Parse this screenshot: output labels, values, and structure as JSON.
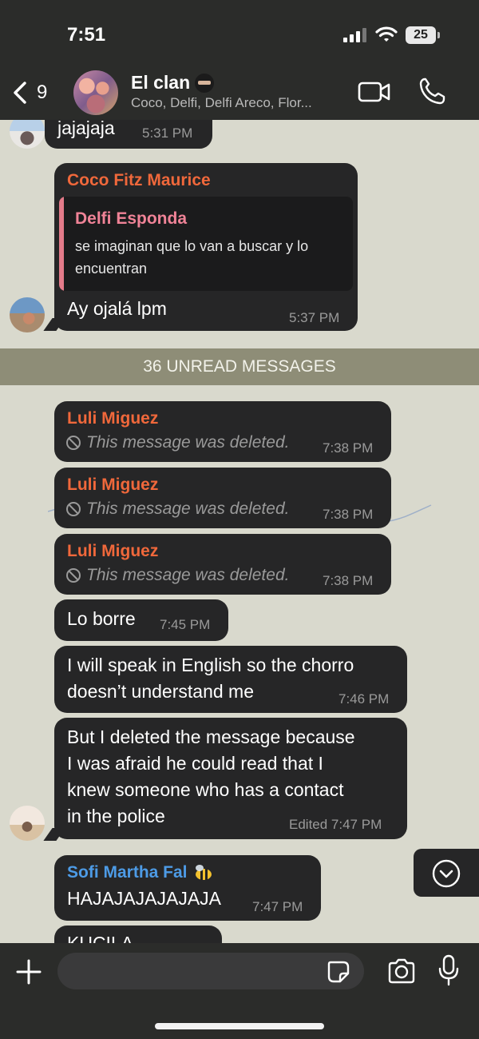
{
  "status_bar": {
    "time": "7:51",
    "battery": "25"
  },
  "header": {
    "back_count": "9",
    "title": "El clan",
    "members": "Coco, Delfi, Delfi Areco, Flor..."
  },
  "colors": {
    "sender_orange": "#f0683b",
    "sender_blue": "#4d9be6",
    "quote_pink": "#f08397",
    "unread_bar": "#8e8d77"
  },
  "messages": [
    {
      "text": "jajajaja",
      "time": "5:31 PM"
    },
    {
      "sender": "Coco Fitz Maurice",
      "quote": {
        "sender": "Delfi Esponda",
        "text": "se imaginan que lo van a buscar y lo encuentran"
      },
      "text": "Ay ojalá lpm",
      "time": "5:37 PM"
    },
    {
      "sender": "Luli  Miguez",
      "deleted_text": "This message was deleted.",
      "time": "7:38 PM"
    },
    {
      "sender": "Luli  Miguez",
      "deleted_text": "This message was deleted.",
      "time": "7:38 PM"
    },
    {
      "sender": "Luli  Miguez",
      "deleted_text": "This message was deleted.",
      "time": "7:38 PM"
    },
    {
      "text": "Lo borre",
      "time": "7:45 PM"
    },
    {
      "line1": "I will speak in English so the chorro",
      "line2": "doesn’t understand me",
      "time": "7:46 PM"
    },
    {
      "line1": "But I deleted the message because",
      "line2": "I was afraid he could read that I",
      "line3": "knew someone who has a contact",
      "line4": "in the police",
      "time": "Edited 7:47 PM"
    },
    {
      "sender": "Sofi Martha Fal",
      "text": "HAJAJAJAJAJAJA",
      "time": "7:47 PM"
    },
    {
      "text": "KUCILA"
    }
  ],
  "unread_banner": "36 UNREAD MESSAGES",
  "input": {
    "placeholder": ""
  }
}
